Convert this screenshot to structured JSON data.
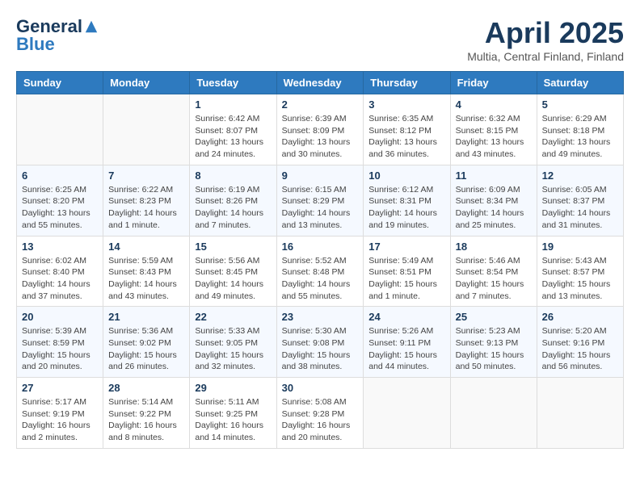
{
  "header": {
    "logo_general": "General",
    "logo_blue": "Blue",
    "month_title": "April 2025",
    "location": "Multia, Central Finland, Finland"
  },
  "days_of_week": [
    "Sunday",
    "Monday",
    "Tuesday",
    "Wednesday",
    "Thursday",
    "Friday",
    "Saturday"
  ],
  "weeks": [
    [
      {
        "day": "",
        "info": ""
      },
      {
        "day": "",
        "info": ""
      },
      {
        "day": "1",
        "info": "Sunrise: 6:42 AM\nSunset: 8:07 PM\nDaylight: 13 hours\nand 24 minutes."
      },
      {
        "day": "2",
        "info": "Sunrise: 6:39 AM\nSunset: 8:09 PM\nDaylight: 13 hours\nand 30 minutes."
      },
      {
        "day": "3",
        "info": "Sunrise: 6:35 AM\nSunset: 8:12 PM\nDaylight: 13 hours\nand 36 minutes."
      },
      {
        "day": "4",
        "info": "Sunrise: 6:32 AM\nSunset: 8:15 PM\nDaylight: 13 hours\nand 43 minutes."
      },
      {
        "day": "5",
        "info": "Sunrise: 6:29 AM\nSunset: 8:18 PM\nDaylight: 13 hours\nand 49 minutes."
      }
    ],
    [
      {
        "day": "6",
        "info": "Sunrise: 6:25 AM\nSunset: 8:20 PM\nDaylight: 13 hours\nand 55 minutes."
      },
      {
        "day": "7",
        "info": "Sunrise: 6:22 AM\nSunset: 8:23 PM\nDaylight: 14 hours\nand 1 minute."
      },
      {
        "day": "8",
        "info": "Sunrise: 6:19 AM\nSunset: 8:26 PM\nDaylight: 14 hours\nand 7 minutes."
      },
      {
        "day": "9",
        "info": "Sunrise: 6:15 AM\nSunset: 8:29 PM\nDaylight: 14 hours\nand 13 minutes."
      },
      {
        "day": "10",
        "info": "Sunrise: 6:12 AM\nSunset: 8:31 PM\nDaylight: 14 hours\nand 19 minutes."
      },
      {
        "day": "11",
        "info": "Sunrise: 6:09 AM\nSunset: 8:34 PM\nDaylight: 14 hours\nand 25 minutes."
      },
      {
        "day": "12",
        "info": "Sunrise: 6:05 AM\nSunset: 8:37 PM\nDaylight: 14 hours\nand 31 minutes."
      }
    ],
    [
      {
        "day": "13",
        "info": "Sunrise: 6:02 AM\nSunset: 8:40 PM\nDaylight: 14 hours\nand 37 minutes."
      },
      {
        "day": "14",
        "info": "Sunrise: 5:59 AM\nSunset: 8:43 PM\nDaylight: 14 hours\nand 43 minutes."
      },
      {
        "day": "15",
        "info": "Sunrise: 5:56 AM\nSunset: 8:45 PM\nDaylight: 14 hours\nand 49 minutes."
      },
      {
        "day": "16",
        "info": "Sunrise: 5:52 AM\nSunset: 8:48 PM\nDaylight: 14 hours\nand 55 minutes."
      },
      {
        "day": "17",
        "info": "Sunrise: 5:49 AM\nSunset: 8:51 PM\nDaylight: 15 hours\nand 1 minute."
      },
      {
        "day": "18",
        "info": "Sunrise: 5:46 AM\nSunset: 8:54 PM\nDaylight: 15 hours\nand 7 minutes."
      },
      {
        "day": "19",
        "info": "Sunrise: 5:43 AM\nSunset: 8:57 PM\nDaylight: 15 hours\nand 13 minutes."
      }
    ],
    [
      {
        "day": "20",
        "info": "Sunrise: 5:39 AM\nSunset: 8:59 PM\nDaylight: 15 hours\nand 20 minutes."
      },
      {
        "day": "21",
        "info": "Sunrise: 5:36 AM\nSunset: 9:02 PM\nDaylight: 15 hours\nand 26 minutes."
      },
      {
        "day": "22",
        "info": "Sunrise: 5:33 AM\nSunset: 9:05 PM\nDaylight: 15 hours\nand 32 minutes."
      },
      {
        "day": "23",
        "info": "Sunrise: 5:30 AM\nSunset: 9:08 PM\nDaylight: 15 hours\nand 38 minutes."
      },
      {
        "day": "24",
        "info": "Sunrise: 5:26 AM\nSunset: 9:11 PM\nDaylight: 15 hours\nand 44 minutes."
      },
      {
        "day": "25",
        "info": "Sunrise: 5:23 AM\nSunset: 9:13 PM\nDaylight: 15 hours\nand 50 minutes."
      },
      {
        "day": "26",
        "info": "Sunrise: 5:20 AM\nSunset: 9:16 PM\nDaylight: 15 hours\nand 56 minutes."
      }
    ],
    [
      {
        "day": "27",
        "info": "Sunrise: 5:17 AM\nSunset: 9:19 PM\nDaylight: 16 hours\nand 2 minutes."
      },
      {
        "day": "28",
        "info": "Sunrise: 5:14 AM\nSunset: 9:22 PM\nDaylight: 16 hours\nand 8 minutes."
      },
      {
        "day": "29",
        "info": "Sunrise: 5:11 AM\nSunset: 9:25 PM\nDaylight: 16 hours\nand 14 minutes."
      },
      {
        "day": "30",
        "info": "Sunrise: 5:08 AM\nSunset: 9:28 PM\nDaylight: 16 hours\nand 20 minutes."
      },
      {
        "day": "",
        "info": ""
      },
      {
        "day": "",
        "info": ""
      },
      {
        "day": "",
        "info": ""
      }
    ]
  ]
}
